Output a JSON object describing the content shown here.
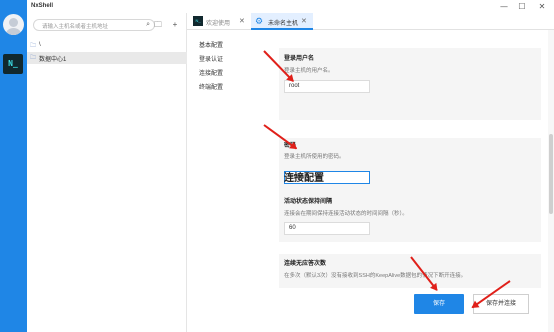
{
  "app": {
    "title": "NxShell"
  },
  "rail": {
    "app_icon_text": "N_"
  },
  "window": {
    "minimize": "—",
    "maximize": "☐",
    "close": "✕"
  },
  "sidebar": {
    "search_placeholder": "请输入主机名或者主机地址",
    "tree": [
      {
        "label": "\\"
      },
      {
        "label": "数据中心1"
      }
    ]
  },
  "tabs": [
    {
      "label": "欢迎使用",
      "close": "✕"
    },
    {
      "label": "未命名主机",
      "close": "✕"
    }
  ],
  "settings_nav": [
    "基本配置",
    "登录认证",
    "连接配置",
    "终端配置"
  ],
  "form": {
    "username": {
      "title": "登录用户名",
      "desc": "登录主机的用户名。",
      "value": "root"
    },
    "password": {
      "title": "密码",
      "desc": "登录主机所使用的密码。",
      "value": "•••••••"
    },
    "section_connection": "连接配置",
    "keepalive": {
      "title": "活动状态保持间隔",
      "desc": "连接会在期间保持连接活动状态的时间间隔（秒）。",
      "value": "60"
    },
    "retry": {
      "title": "连续无应答次数",
      "desc": "在多次（默认3次）没有接收到SSH的KeepAlive数据包的情况下断开连接。"
    }
  },
  "buttons": {
    "save": "保存",
    "save_connect": "保存并连接"
  }
}
